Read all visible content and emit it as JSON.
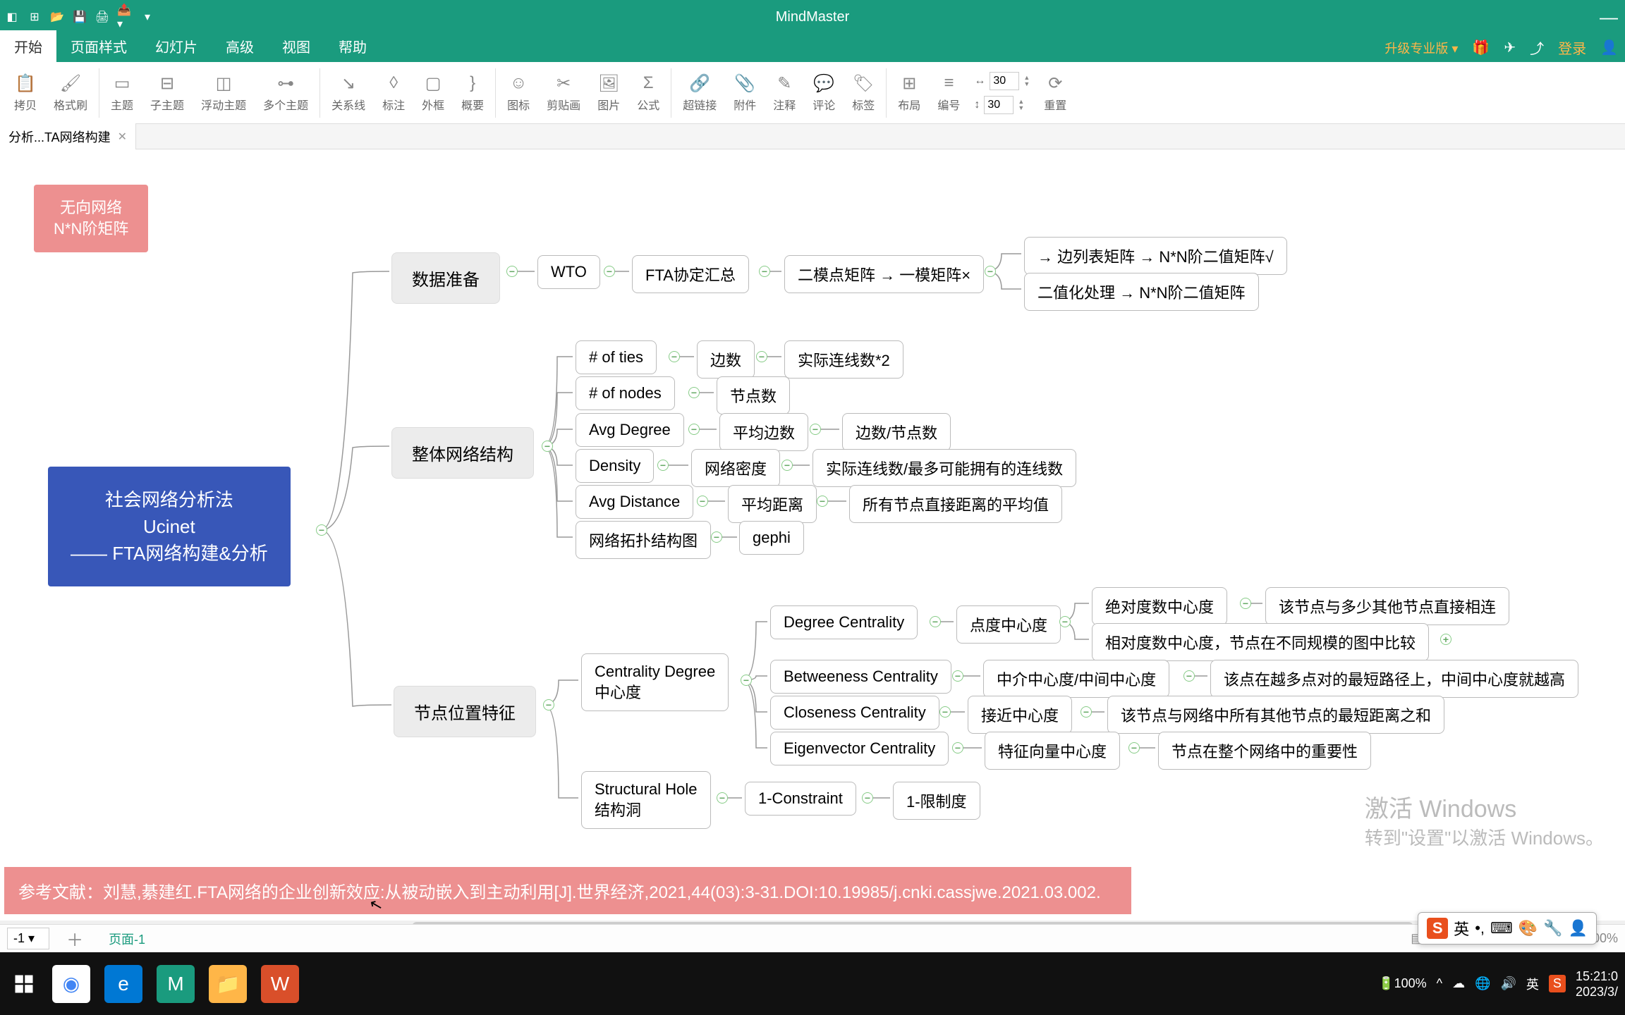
{
  "app": {
    "title": "MindMaster",
    "min": "—"
  },
  "menus": {
    "tabs": [
      "开始",
      "页面样式",
      "幻灯片",
      "高级",
      "视图",
      "帮助"
    ],
    "upgrade": "升级专业版",
    "login": "登录"
  },
  "ribbon": {
    "items": [
      "拷贝",
      "格式刷",
      "主题",
      "子主题",
      "浮动主题",
      "多个主题",
      "关系线",
      "标注",
      "外框",
      "概要",
      "图标",
      "剪贴画",
      "图片",
      "公式",
      "超链接",
      "附件",
      "注释",
      "评论",
      "标签",
      "布局",
      "编号",
      "重置"
    ],
    "spinA_label": "↔",
    "spinA": "30",
    "spinB_label": "↕",
    "spinB": "30"
  },
  "doctab": {
    "name": "分析...TA网络构建"
  },
  "floats": {
    "network": "无向网络\nN*N阶矩阵",
    "ref": "参考文献：刘慧,綦建红.FTA网络的企业创新效应:从被动嵌入到主动利用[J].世界经济,2021,44(03):3-31.DOI:10.19985/j.cnki.cassjwe.2021.03.002."
  },
  "root": "社会网络分析法\nUcinet\n—— FTA网络构建&分析",
  "n": {
    "dataprep": "数据准备",
    "wto": "WTO",
    "fta": "FTA协定汇总",
    "twomode": "二模点矩阵 → 一模矩阵×",
    "edge1": "→ 边列表矩阵 → N*N阶二值矩阵√",
    "edge2": "二值化处理 → N*N阶二值矩阵",
    "wholenet": "整体网络结构",
    "ties": "# of ties",
    "ties2": "边数",
    "ties3": "实际连线数*2",
    "nodes": "# of nodes",
    "nodes2": "节点数",
    "avgdeg": "Avg Degree",
    "avgdeg2": "平均边数",
    "avgdeg3": "边数/节点数",
    "density": "Density",
    "density2": "网络密度",
    "density3": "实际连线数/最多可能拥有的连线数",
    "avgdist": "Avg Distance",
    "avgdist2": "平均距离",
    "avgdist3": "所有节点直接距离的平均值",
    "topo": "网络拓扑结构图",
    "gephi": "gephi",
    "nodepos": "节点位置特征",
    "cent": "Centrality Degree\n中心度",
    "degcent": "Degree Centrality",
    "degcent2": "点度中心度",
    "degcent3": "绝对度数中心度",
    "degcent4": "该节点与多少其他节点直接相连",
    "degcent5": "相对度数中心度，节点在不同规模的图中比较",
    "betw": "Betweeness Centrality",
    "betw2": "中介中心度/中间中心度",
    "betw3": "该点在越多点对的最短路径上，中间中心度就越高",
    "close": "Closeness Centrality",
    "close2": "接近中心度",
    "close3": "该节点与网络中所有其他节点的最短距离之和",
    "eigen": "Eigenvector Centrality",
    "eigen2": "特征向量中心度",
    "eigen3": "节点在整个网络中的重要性",
    "hole": "Structural Hole\n结构洞",
    "hole2": "1-Constraint",
    "hole3": "1-限制度"
  },
  "bottombar": {
    "pagesel": "-1",
    "page": "页面-1",
    "zoom": "100%"
  },
  "watermark": {
    "l1": "激活 Windows",
    "l2": "转到\"设置\"以激活 Windows。"
  },
  "tray": {
    "battery": "100%",
    "ime": "英",
    "clock_time": "15:21:0",
    "clock_date": "2023/3/"
  },
  "ime_float": {
    "lang": "英",
    "punct": "•,"
  }
}
